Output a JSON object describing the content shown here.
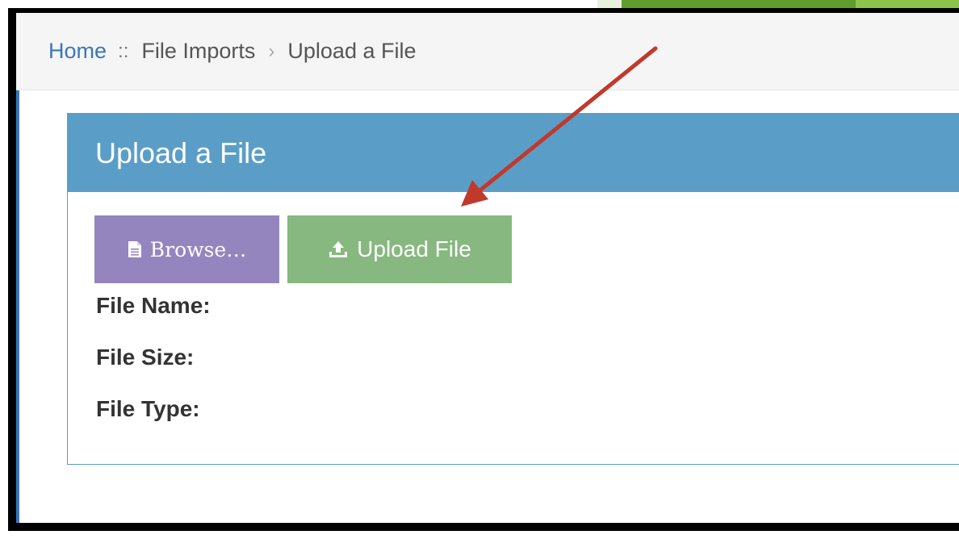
{
  "breadcrumb": {
    "home": "Home",
    "separator": "::",
    "section": "File Imports",
    "chevron": "›",
    "current": "Upload a File"
  },
  "panel": {
    "title": "Upload a File"
  },
  "buttons": {
    "browse_label": "Browse…",
    "browse_icon": "file-icon",
    "upload_label": "Upload File",
    "upload_icon": "upload-icon"
  },
  "file_info": {
    "name_label": "File Name:",
    "size_label": "File Size:",
    "type_label": "File Type:"
  },
  "colors": {
    "header_blue": "#5a9ec7",
    "browse_purple": "#9585bf",
    "upload_green": "#87b87f",
    "link_blue": "#3a77b8",
    "arrow_red": "#c0392b"
  }
}
